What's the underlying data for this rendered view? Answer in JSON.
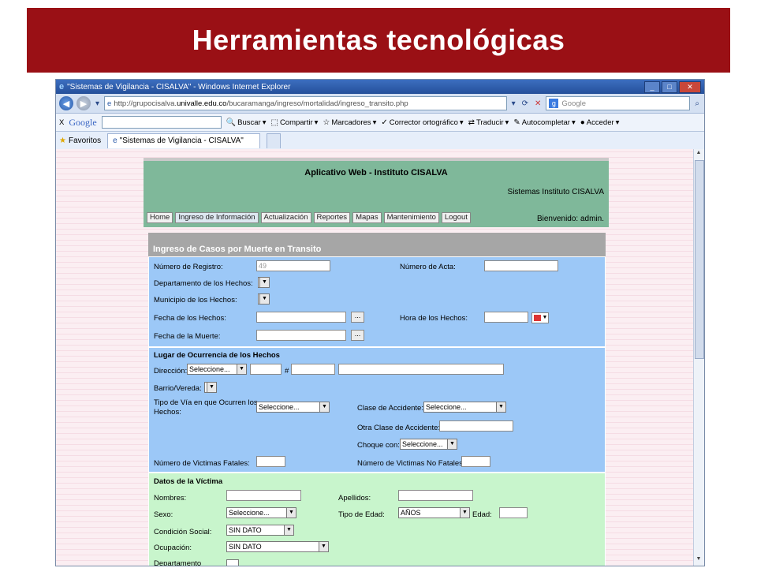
{
  "slide": {
    "title": "Herramientas tecnológicas"
  },
  "browser": {
    "window_title": "\"Sistemas de Vigilancia - CISALVA\" - Windows Internet Explorer",
    "address_prefix": "http://grupocisalva.",
    "address_domain": "univalle.edu.co",
    "address_path": "/bucaramanga/ingreso/mortalidad/ingreso_transito.php",
    "search_placeholder": "Google",
    "google_toolbar": {
      "close": "X",
      "logo": "Google",
      "items": [
        "Buscar",
        "Compartir",
        "Marcadores",
        "Corrector ortográfico",
        "Traducir",
        "Autocompletar",
        "Acceder"
      ]
    },
    "favorites_label": "Favoritos",
    "tab_label": "\"Sistemas de Vigilancia - CISALVA\""
  },
  "app": {
    "title": "Aplicativo Web - Instituto CISALVA",
    "subtitle": "Sistemas Instituto CISALVA",
    "nav": [
      "Home",
      "Ingreso de Información",
      "Actualización",
      "Reportes",
      "Mapas",
      "Mantenimiento",
      "Logout"
    ],
    "welcome": "Bienvenido: admin."
  },
  "form": {
    "title": "Ingreso de Casos por Muerte en Transito",
    "general": {
      "registro_label": "Número de Registro:",
      "registro_value": "49",
      "acta_label": "Número de Acta:",
      "departamento_label": "Departamento de los Hechos:",
      "municipio_label": "Municipio de los Hechos:",
      "fecha_hechos_label": "Fecha de los Hechos:",
      "hora_hechos_label": "Hora de los Hechos:",
      "fecha_muerte_label": "Fecha de la Muerte:",
      "dots": "..."
    },
    "lugar": {
      "heading": "Lugar de Ocurrencia de los Hechos",
      "direccion_label": "Dirección:",
      "direccion_select": "Seleccione...",
      "hash": "#",
      "barrio_label": "Barrio/Vereda:",
      "tipo_via_label_1": "Tipo de Vía en que Ocurren los",
      "tipo_via_label_2": "Hechos:",
      "tipo_via_select": "Seleccione...",
      "clase_label": "Clase de Accidente:",
      "clase_select": "Seleccione...",
      "otra_clase_label": "Otra Clase de Accidente:",
      "choque_label": "Choque con:",
      "choque_select": "Seleccione...",
      "victimas_fatales_label": "Número de Victimas Fatales:",
      "victimas_no_fatales_label": "Número de Victimas No Fatales:"
    },
    "victima": {
      "heading": "Datos de la Víctima",
      "nombres_label": "Nombres:",
      "apellidos_label": "Apellidos:",
      "sexo_label": "Sexo:",
      "sexo_select": "Seleccione...",
      "tipo_edad_label": "Tipo de Edad:",
      "tipo_edad_select": "AÑOS",
      "edad_label": "Edad:",
      "condicion_label": "Condición Social:",
      "condicion_select": "SIN DATO",
      "ocupacion_label": "Ocupación:",
      "ocupacion_select": "SIN DATO",
      "departamento_label": "Departamento"
    }
  }
}
